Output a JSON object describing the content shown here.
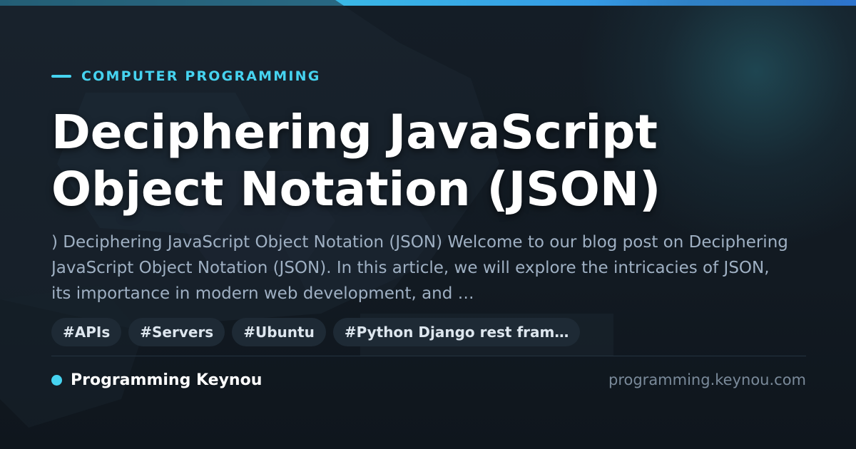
{
  "category": "COMPUTER PROGRAMMING",
  "title": "Deciphering JavaScript Object Notation (JSON)",
  "excerpt": ") Deciphering JavaScript Object Notation (JSON) Welcome to our blog post on Deciphering JavaScript Object Notation (JSON). In this article, we will explore the intricacies of JSON, its importance in modern web development, and …",
  "tags": [
    "#APIs",
    "#Servers",
    "#Ubuntu",
    "#Python Django rest fram…"
  ],
  "footer": {
    "brand": "Programming Keynou",
    "domain": "programming.keynou.com"
  },
  "colors": {
    "accent": "#46d3f0",
    "background": "#141d26",
    "title": "#ffffff",
    "excerpt": "#9fb0c3",
    "tag_background": "#1e2a35",
    "domain": "#7a8a9a"
  },
  "icons": {
    "kicker": "accent-line-icon",
    "brand": "dot-icon"
  }
}
